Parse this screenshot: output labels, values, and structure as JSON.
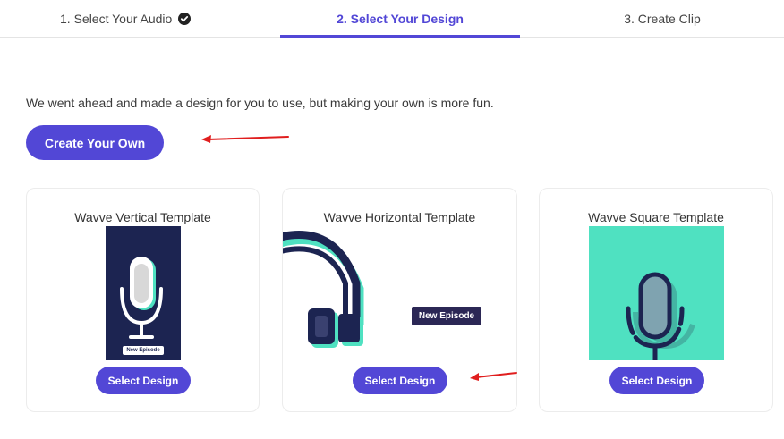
{
  "tabs": [
    {
      "label": "1. Select Your Audio",
      "completed": true,
      "active": false
    },
    {
      "label": "2. Select Your Design",
      "completed": false,
      "active": true
    },
    {
      "label": "3. Create Clip",
      "completed": false,
      "active": false
    }
  ],
  "intro_text": "We went ahead and made a design for you to use, but making your own is more fun.",
  "create_button_label": "Create Your Own",
  "templates": [
    {
      "title": "Wavve Vertical Template",
      "select_label": "Select Design",
      "badge": "New Episode",
      "icon": "microphone-icon"
    },
    {
      "title": "Wavve Horizontal Template",
      "select_label": "Select Design",
      "badge": "New Episode",
      "icon": "headphones-icon"
    },
    {
      "title": "Wavve Square Template",
      "select_label": "Select Design",
      "icon": "microphone-icon"
    }
  ],
  "colors": {
    "accent": "#5247d6",
    "navy": "#1c2451",
    "mint": "#4fe1c1",
    "arrow": "#e01e1e"
  }
}
